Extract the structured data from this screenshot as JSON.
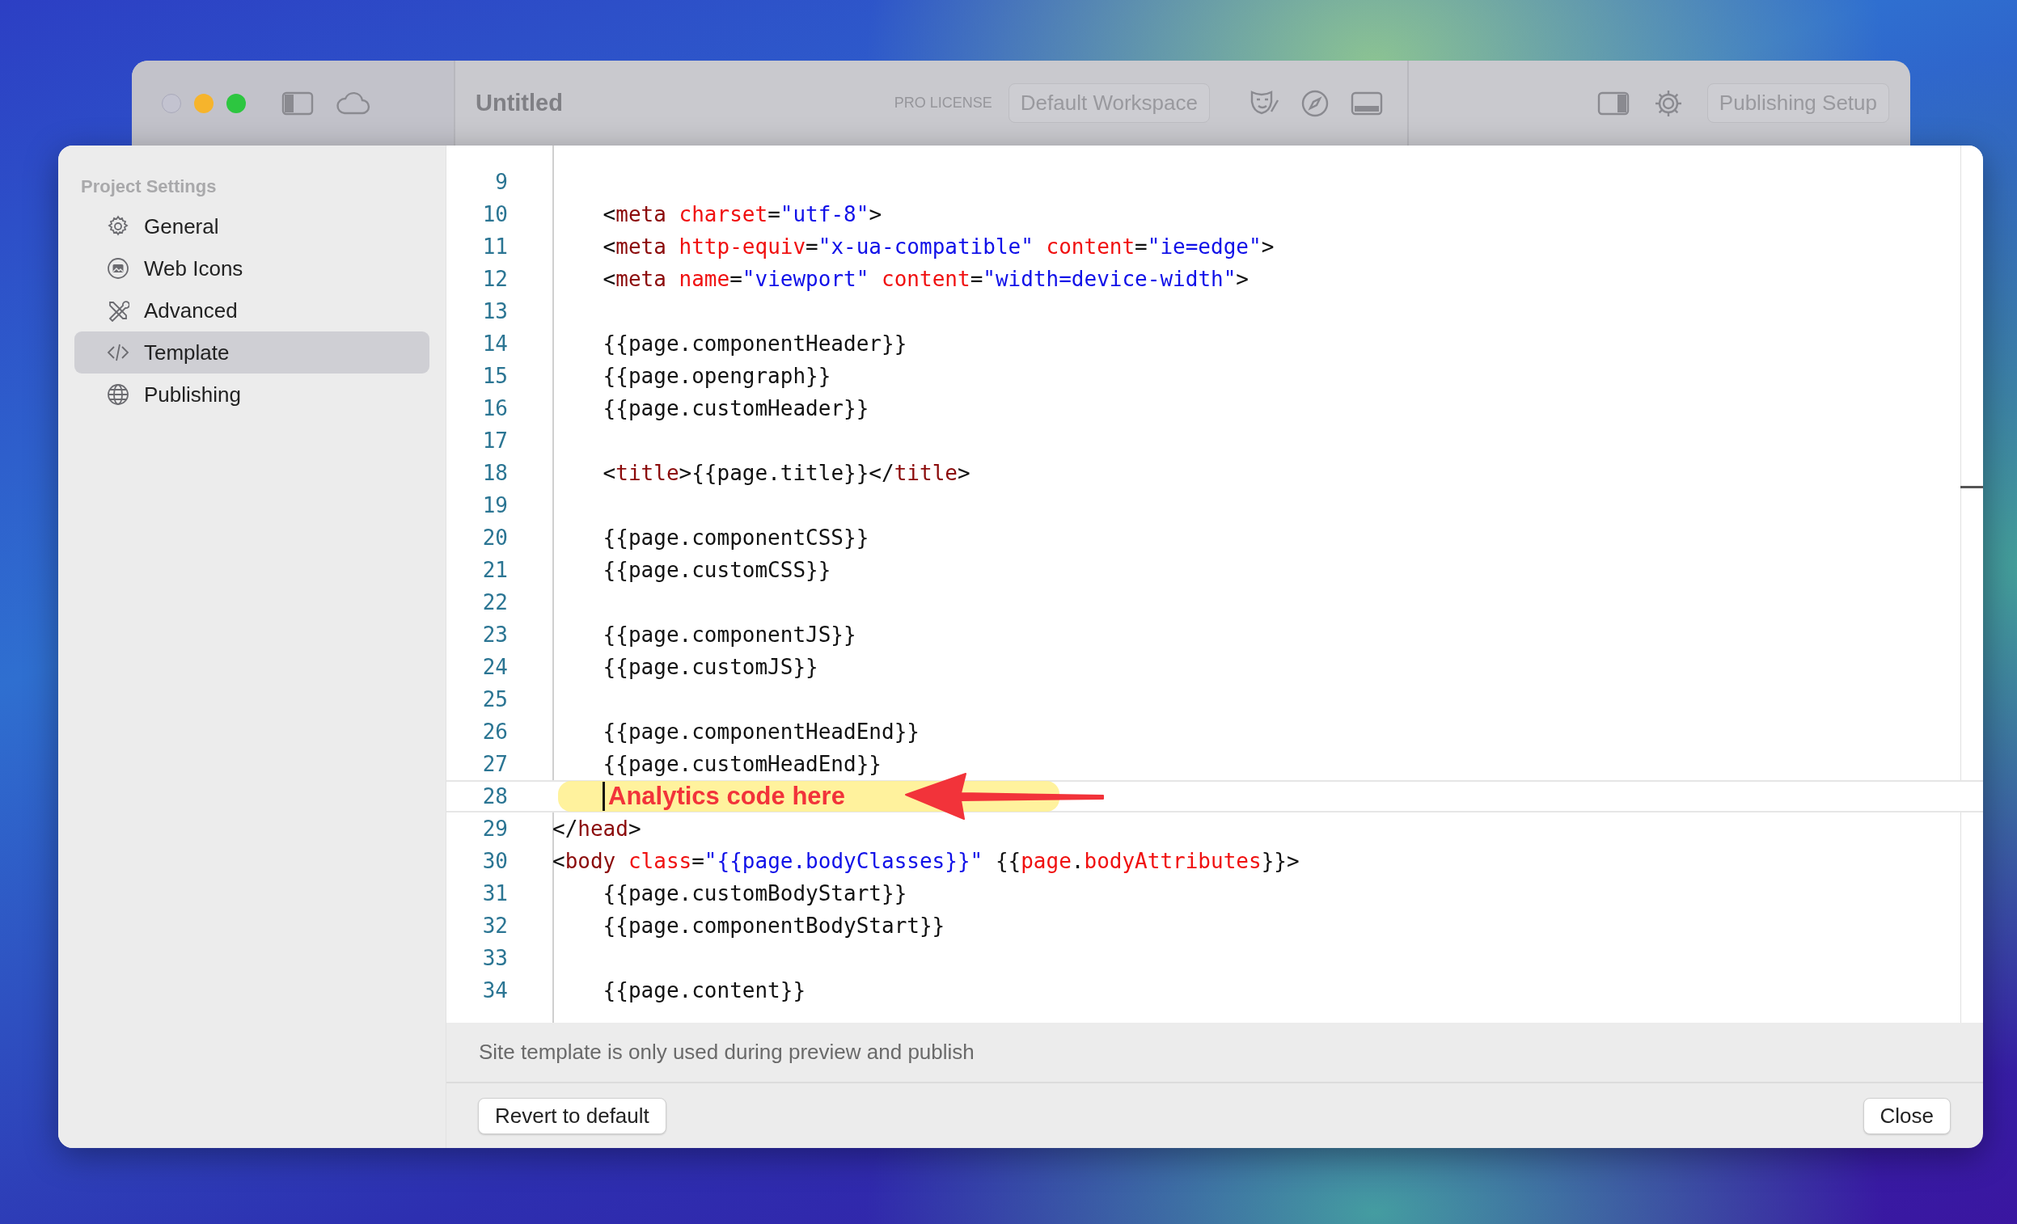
{
  "background_window": {
    "title": "Untitled",
    "license": "PRO LICENSE",
    "workspace_button": "Default Workspace",
    "publishing_button": "Publishing Setup"
  },
  "sidebar": {
    "heading": "Project Settings",
    "items": [
      {
        "label": "General",
        "selected": false
      },
      {
        "label": "Web Icons",
        "selected": false
      },
      {
        "label": "Advanced",
        "selected": false
      },
      {
        "label": "Template",
        "selected": true
      },
      {
        "label": "Publishing",
        "selected": false
      }
    ]
  },
  "editor": {
    "lines": [
      {
        "number": "9",
        "current": false
      },
      {
        "number": "10",
        "current": false,
        "tokens": [
          {
            "kind": "text",
            "text": "    <"
          },
          {
            "kind": "tag",
            "text": "meta"
          },
          {
            "kind": "attr",
            "text": " charset"
          },
          {
            "kind": "text",
            "text": "="
          },
          {
            "kind": "string",
            "text": "\"utf-8\""
          },
          {
            "kind": "text",
            "text": ">"
          }
        ]
      },
      {
        "number": "11",
        "current": false,
        "tokens": [
          {
            "kind": "text",
            "text": "    <"
          },
          {
            "kind": "tag",
            "text": "meta"
          },
          {
            "kind": "attr",
            "text": " http-equiv"
          },
          {
            "kind": "text",
            "text": "="
          },
          {
            "kind": "string",
            "text": "\"x-ua-compatible\""
          },
          {
            "kind": "attr",
            "text": " content"
          },
          {
            "kind": "text",
            "text": "="
          },
          {
            "kind": "string",
            "text": "\"ie=edge\""
          },
          {
            "kind": "text",
            "text": ">"
          }
        ]
      },
      {
        "number": "12",
        "current": false,
        "tokens": [
          {
            "kind": "text",
            "text": "    <"
          },
          {
            "kind": "tag",
            "text": "meta"
          },
          {
            "kind": "attr",
            "text": " name"
          },
          {
            "kind": "text",
            "text": "="
          },
          {
            "kind": "string",
            "text": "\"viewport\""
          },
          {
            "kind": "attr",
            "text": " content"
          },
          {
            "kind": "text",
            "text": "="
          },
          {
            "kind": "string",
            "text": "\"width=device-width\""
          },
          {
            "kind": "text",
            "text": ">"
          }
        ]
      },
      {
        "number": "13",
        "current": false
      },
      {
        "number": "14",
        "current": false,
        "tokens": [
          {
            "kind": "text",
            "text": "    {{page.componentHeader}}"
          }
        ]
      },
      {
        "number": "15",
        "current": false,
        "tokens": [
          {
            "kind": "text",
            "text": "    {{page.opengraph}}"
          }
        ]
      },
      {
        "number": "16",
        "current": false,
        "tokens": [
          {
            "kind": "text",
            "text": "    {{page.customHeader}}"
          }
        ]
      },
      {
        "number": "17",
        "current": false
      },
      {
        "number": "18",
        "current": false,
        "tokens": [
          {
            "kind": "text",
            "text": "    <"
          },
          {
            "kind": "tag",
            "text": "title"
          },
          {
            "kind": "text",
            "text": ">{{page.title}}</"
          },
          {
            "kind": "tag",
            "text": "title"
          },
          {
            "kind": "text",
            "text": ">"
          }
        ]
      },
      {
        "number": "19",
        "current": false
      },
      {
        "number": "20",
        "current": false,
        "tokens": [
          {
            "kind": "text",
            "text": "    {{page.componentCSS}}"
          }
        ]
      },
      {
        "number": "21",
        "current": false,
        "tokens": [
          {
            "kind": "text",
            "text": "    {{page.customCSS}}"
          }
        ]
      },
      {
        "number": "22",
        "current": false
      },
      {
        "number": "23",
        "current": false,
        "tokens": [
          {
            "kind": "text",
            "text": "    {{page.componentJS}}"
          }
        ]
      },
      {
        "number": "24",
        "current": false,
        "tokens": [
          {
            "kind": "text",
            "text": "    {{page.customJS}}"
          }
        ]
      },
      {
        "number": "25",
        "current": false
      },
      {
        "number": "26",
        "current": false,
        "tokens": [
          {
            "kind": "text",
            "text": "    {{page.componentHeadEnd}}"
          }
        ]
      },
      {
        "number": "27",
        "current": false,
        "tokens": [
          {
            "kind": "text",
            "text": "    {{page.customHeadEnd}}"
          }
        ]
      },
      {
        "number": "28",
        "current": true,
        "annotation": "Analytics code here"
      },
      {
        "number": "29",
        "current": false,
        "tokens": [
          {
            "kind": "text",
            "text": "</"
          },
          {
            "kind": "tag",
            "text": "head"
          },
          {
            "kind": "text",
            "text": ">"
          }
        ]
      },
      {
        "number": "30",
        "current": false,
        "tokens": [
          {
            "kind": "text",
            "text": "<"
          },
          {
            "kind": "tag",
            "text": "body"
          },
          {
            "kind": "attr",
            "text": " class"
          },
          {
            "kind": "text",
            "text": "="
          },
          {
            "kind": "string",
            "text": "\"{{page.bodyClasses}}\""
          },
          {
            "kind": "text",
            "text": " {{"
          },
          {
            "kind": "attr",
            "text": "page"
          },
          {
            "kind": "text",
            "text": "."
          },
          {
            "kind": "attr",
            "text": "bodyAttributes"
          },
          {
            "kind": "text",
            "text": "}}>"
          }
        ]
      },
      {
        "number": "31",
        "current": false,
        "tokens": [
          {
            "kind": "text",
            "text": "    {{page.customBodyStart}}"
          }
        ]
      },
      {
        "number": "32",
        "current": false,
        "tokens": [
          {
            "kind": "text",
            "text": "    {{page.componentBodyStart}}"
          }
        ]
      },
      {
        "number": "33",
        "current": false
      },
      {
        "number": "34",
        "current": false,
        "tokens": [
          {
            "kind": "text",
            "text": "    {{page.content}}"
          }
        ]
      }
    ]
  },
  "footer": {
    "note": "Site template is only used during preview and publish",
    "buttons": [
      "Revert to default",
      "Close"
    ]
  }
}
